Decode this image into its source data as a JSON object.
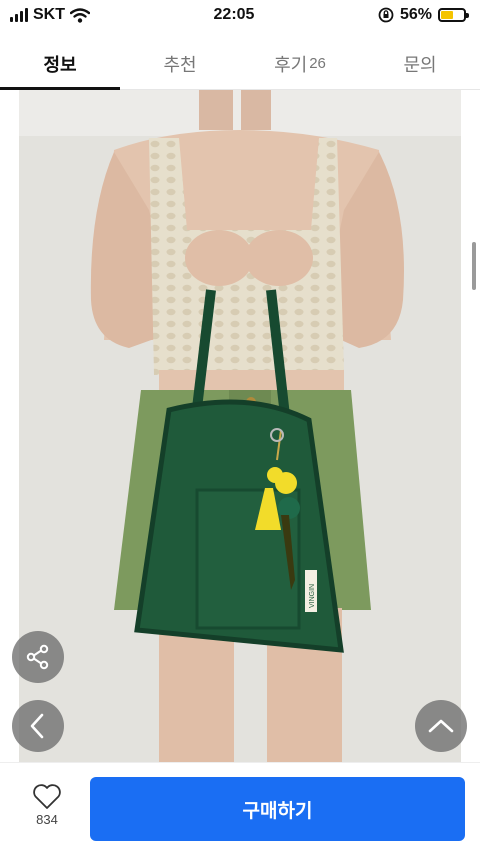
{
  "status_bar": {
    "carrier": "SKT",
    "time": "22:05",
    "battery_percent": "56%",
    "battery_level": 0.56,
    "icons": [
      "signal-icon",
      "wifi-icon",
      "orientation-lock-icon",
      "battery-icon"
    ]
  },
  "tabs": [
    {
      "label": "정보",
      "active": true
    },
    {
      "label": "추천",
      "active": false
    },
    {
      "label": "후기",
      "count": "26",
      "active": false
    },
    {
      "label": "문의",
      "active": false
    }
  ],
  "product_image": {
    "subject": "model holding green canvas tote bag with yellow tassel charm",
    "tag_text": "VINGIN",
    "colors": {
      "bag": "#1f5a3a",
      "skirt": "#7d9a5e",
      "top": "#e6dfcc",
      "background": "#e3e2dd",
      "tassel": "#f2dc2a"
    }
  },
  "floating_buttons": {
    "share": "share-icon",
    "previous": "chevron-left-icon",
    "scroll_top": "chevron-up-icon"
  },
  "bottom_bar": {
    "like_count": "834",
    "buy_label": "구매하기",
    "accent_color": "#1a6ef3"
  }
}
